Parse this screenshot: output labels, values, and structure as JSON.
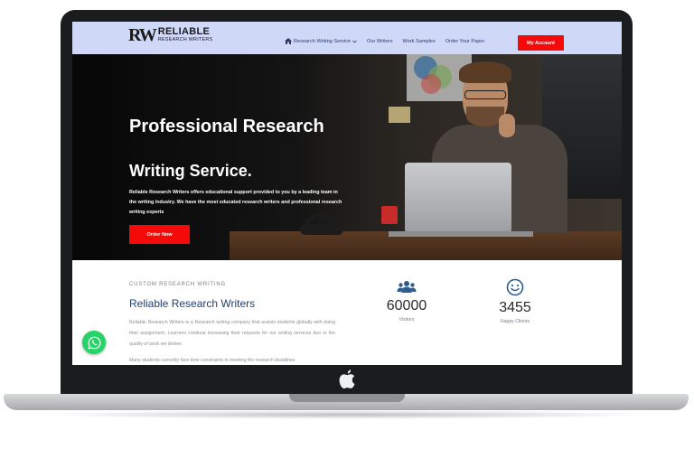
{
  "header": {
    "logo_mark": "RW",
    "logo_line1": "RELIABLE",
    "logo_line2": "RESEARCH WRITERS",
    "nav": [
      {
        "label": "Research Writing Service"
      },
      {
        "label": "Our Writers"
      },
      {
        "label": "Work Samples"
      },
      {
        "label": "Order Your Paper"
      }
    ],
    "account_label": "My Account"
  },
  "hero": {
    "title": "Professional Research",
    "subtitle": "Writing Service.",
    "description": "Reliable Research Writers offers educational support provided to you by a leading team in the writing industry. We have the most educated research writers and professional research writing experts",
    "order_label": "Order Now"
  },
  "about": {
    "kicker": "CUSTOM RESEARCH WRITING",
    "title": "Reliable Research Writers",
    "paragraph": "Reliable Research Writers is a Research writing company that assists students globally with doing their assignment. Learners continue increasing their requests for our writing services due to the quality of work we deliver.",
    "paragraph2": "Many students currently face time constraints in meeting the research deadlines"
  },
  "stats": [
    {
      "icon": "users-icon",
      "value": "60000",
      "label": "Visitors"
    },
    {
      "icon": "smile-icon",
      "value": "3455",
      "label": "Happy Clients"
    }
  ],
  "colors": {
    "header_bg": "#cfd8f7",
    "accent_red": "#f50a0a",
    "navy": "#23406b",
    "icon_blue": "#2c5d8f",
    "whatsapp": "#25d366"
  }
}
